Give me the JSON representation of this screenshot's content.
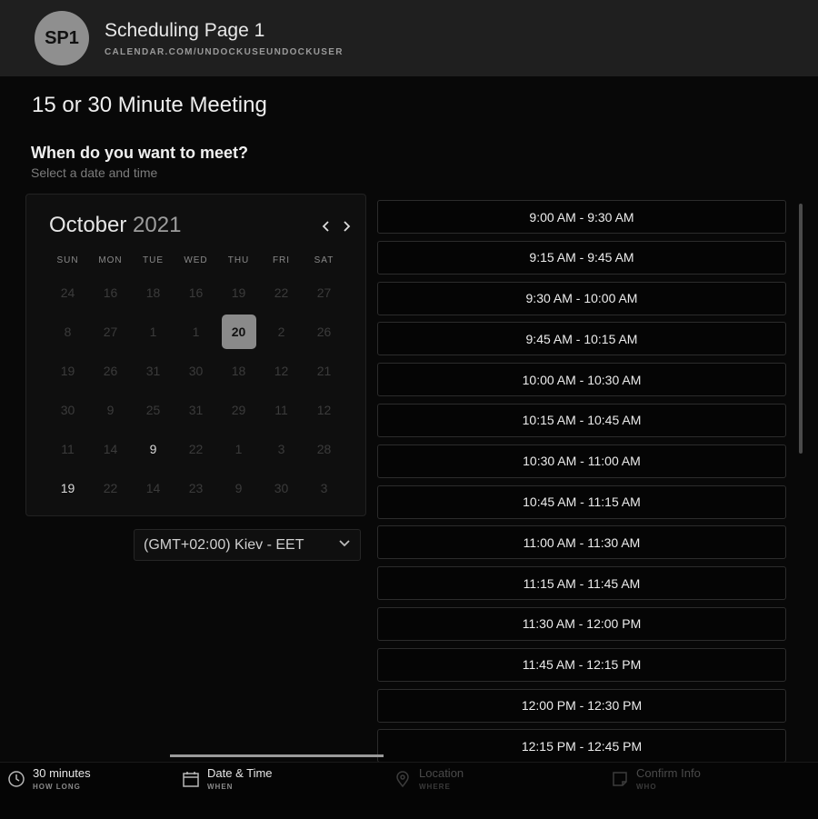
{
  "header": {
    "avatar_initials": "SP1",
    "title": "Scheduling Page 1",
    "url": "CALENDAR.COM/UNDOCKUSEUNDOCKUSER"
  },
  "meeting_title": "15 or 30 Minute Meeting",
  "question": "When do you want to meet?",
  "subtitle": "Select a date and time",
  "calendar": {
    "month": "October",
    "year": "2021",
    "prev_icon": "chevron-left-icon",
    "next_icon": "chevron-right-icon",
    "weekdays": [
      "SUN",
      "MON",
      "TUE",
      "WED",
      "THU",
      "FRI",
      "SAT"
    ],
    "weeks": [
      [
        {
          "d": "24",
          "a": false
        },
        {
          "d": "16",
          "a": false
        },
        {
          "d": "18",
          "a": false
        },
        {
          "d": "16",
          "a": false
        },
        {
          "d": "19",
          "a": false
        },
        {
          "d": "22",
          "a": false
        },
        {
          "d": "27",
          "a": false
        }
      ],
      [
        {
          "d": "8",
          "a": false
        },
        {
          "d": "27",
          "a": false
        },
        {
          "d": "1",
          "a": false
        },
        {
          "d": "1",
          "a": false
        },
        {
          "d": "20",
          "a": true,
          "sel": true
        },
        {
          "d": "2",
          "a": false
        },
        {
          "d": "26",
          "a": false
        }
      ],
      [
        {
          "d": "19",
          "a": false
        },
        {
          "d": "26",
          "a": false
        },
        {
          "d": "31",
          "a": false
        },
        {
          "d": "30",
          "a": false
        },
        {
          "d": "18",
          "a": false
        },
        {
          "d": "12",
          "a": false
        },
        {
          "d": "21",
          "a": false
        }
      ],
      [
        {
          "d": "30",
          "a": false
        },
        {
          "d": "9",
          "a": false
        },
        {
          "d": "25",
          "a": false
        },
        {
          "d": "31",
          "a": false
        },
        {
          "d": "29",
          "a": false
        },
        {
          "d": "11",
          "a": false
        },
        {
          "d": "12",
          "a": false
        }
      ],
      [
        {
          "d": "11",
          "a": false
        },
        {
          "d": "14",
          "a": false
        },
        {
          "d": "9",
          "a": true
        },
        {
          "d": "22",
          "a": false
        },
        {
          "d": "1",
          "a": false
        },
        {
          "d": "3",
          "a": false
        },
        {
          "d": "28",
          "a": false
        }
      ],
      [
        {
          "d": "19",
          "a": true
        },
        {
          "d": "22",
          "a": false
        },
        {
          "d": "14",
          "a": false
        },
        {
          "d": "23",
          "a": false
        },
        {
          "d": "9",
          "a": false
        },
        {
          "d": "30",
          "a": false
        },
        {
          "d": "3",
          "a": false
        }
      ]
    ]
  },
  "timezone": {
    "value": "(GMT+02:00) Kiev - EET",
    "icon": "chevron-down-icon"
  },
  "time_slots": [
    "9:00 AM - 9:30 AM",
    "9:15 AM - 9:45 AM",
    "9:30 AM - 10:00 AM",
    "9:45 AM - 10:15 AM",
    "10:00 AM - 10:30 AM",
    "10:15 AM - 10:45 AM",
    "10:30 AM - 11:00 AM",
    "10:45 AM - 11:15 AM",
    "11:00 AM - 11:30 AM",
    "11:15 AM - 11:45 AM",
    "11:30 AM - 12:00 PM",
    "11:45 AM - 12:15 PM",
    "12:00 PM - 12:30 PM",
    "12:15 PM - 12:45 PM"
  ],
  "steps": [
    {
      "label": "30 minutes",
      "sub": "HOW LONG",
      "icon": "clock-icon",
      "state": "done"
    },
    {
      "label": "Date & Time",
      "sub": "WHEN",
      "icon": "calendar-icon",
      "state": "cur"
    },
    {
      "label": "Location",
      "sub": "WHERE",
      "icon": "map-pin-icon",
      "state": "todo"
    },
    {
      "label": "Confirm Info",
      "sub": "WHO",
      "icon": "note-icon",
      "state": "todo"
    }
  ]
}
